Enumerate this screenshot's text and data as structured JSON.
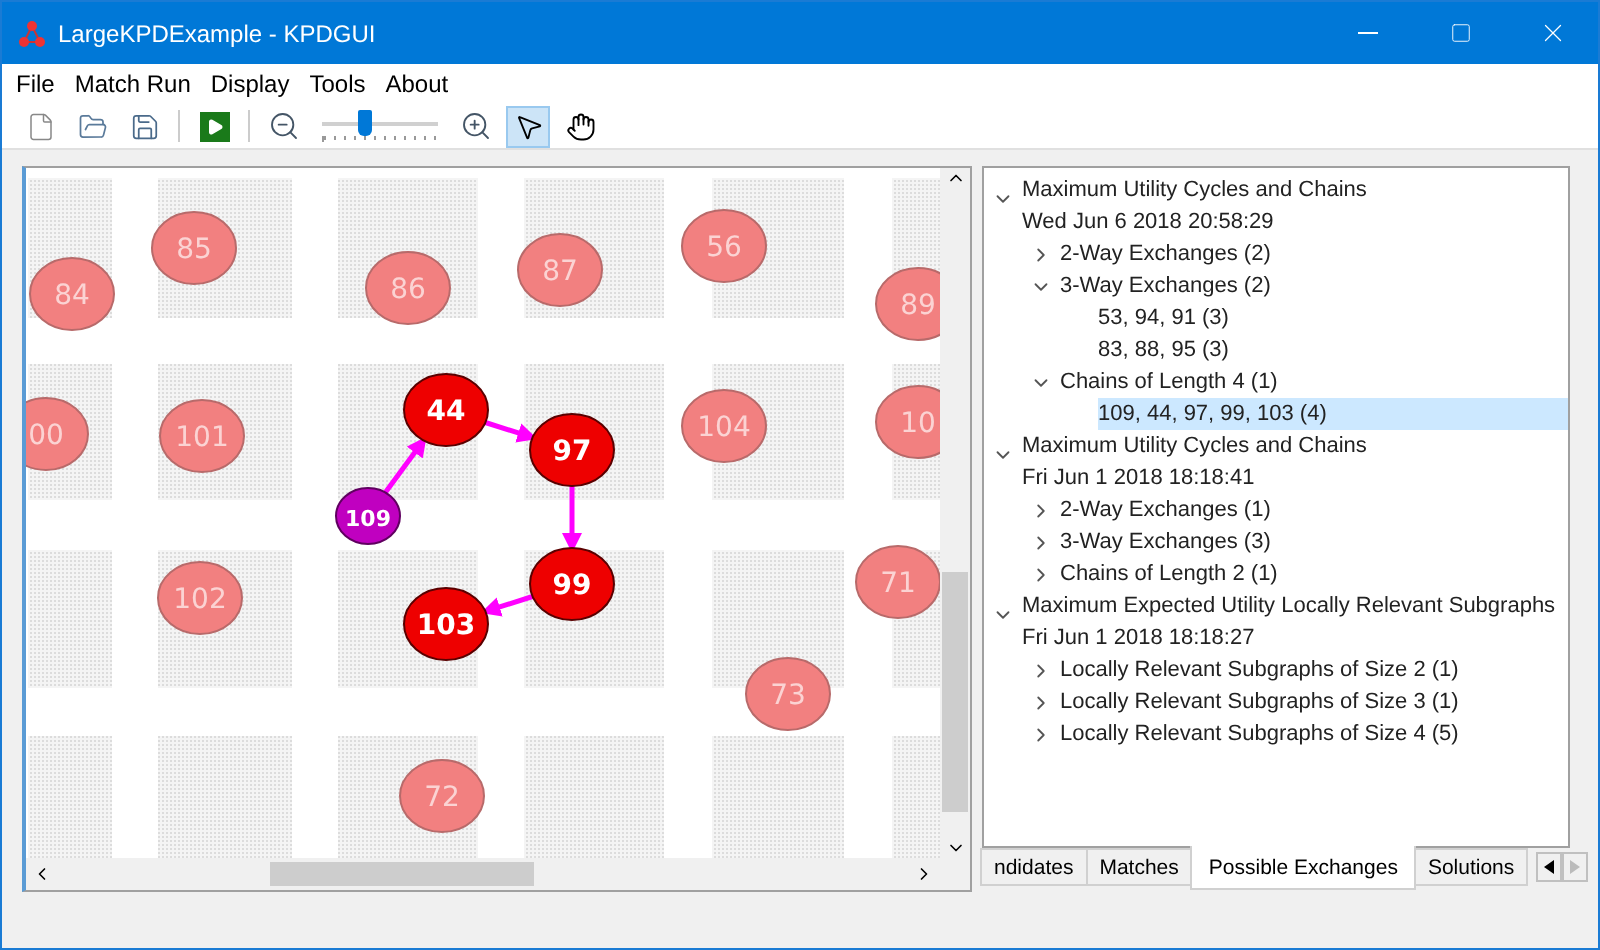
{
  "window": {
    "title": "LargeKPDExample - KPDGUI"
  },
  "menu": [
    "File",
    "Match Run",
    "Display",
    "Tools",
    "About"
  ],
  "toolbar": {
    "zoom": {
      "level": 0.36
    },
    "tools": [
      {
        "kind": "pointer",
        "selected": true
      },
      {
        "kind": "hand",
        "selected": false
      }
    ]
  },
  "graph": {
    "nodes": [
      {
        "label": "84",
        "kind": "unmatched"
      },
      {
        "label": "85",
        "kind": "unmatched"
      },
      {
        "label": "86",
        "kind": "unmatched"
      },
      {
        "label": "87",
        "kind": "unmatched"
      },
      {
        "label": "56",
        "kind": "unmatched"
      },
      {
        "label": "89",
        "kind": "unmatched"
      },
      {
        "label": "00",
        "kind": "unmatched"
      },
      {
        "label": "101",
        "kind": "unmatched"
      },
      {
        "label": "44",
        "kind": "matched"
      },
      {
        "label": "97",
        "kind": "matched"
      },
      {
        "label": "104",
        "kind": "unmatched"
      },
      {
        "label": "10",
        "kind": "unmatched"
      },
      {
        "label": "109",
        "kind": "donor"
      },
      {
        "label": "102",
        "kind": "unmatched"
      },
      {
        "label": "99",
        "kind": "matched"
      },
      {
        "label": "103",
        "kind": "matched"
      },
      {
        "label": "71",
        "kind": "unmatched"
      },
      {
        "label": "73",
        "kind": "unmatched"
      },
      {
        "label": "72",
        "kind": "unmatched"
      }
    ]
  },
  "tree": [
    {
      "title": "Maximum Utility Cycles and Chains",
      "date": "Wed Jun 6 2018 20:58:29",
      "expanded": true,
      "selected": false,
      "children": [
        {
          "label": "2-Way Exchanges (2)",
          "expanded": false,
          "selected": false
        },
        {
          "label": "3-Way Exchanges (2)",
          "expanded": true,
          "selected": false,
          "children": [
            {
              "label": "53, 94, 91 (3)",
              "selected": false
            },
            {
              "label": "83, 88, 95 (3)",
              "selected": false
            }
          ]
        },
        {
          "label": "Chains of Length 4 (1)",
          "expanded": true,
          "selected": false,
          "children": [
            {
              "label": "109, 44, 97, 99, 103 (4)",
              "selected": true
            }
          ]
        }
      ]
    },
    {
      "title": "Maximum Utility Cycles and Chains",
      "date": "Fri Jun 1 2018 18:18:41",
      "expanded": true,
      "selected": false,
      "children": [
        {
          "label": "2-Way Exchanges (1)",
          "expanded": false,
          "selected": false
        },
        {
          "label": "3-Way Exchanges (3)",
          "expanded": false,
          "selected": false
        },
        {
          "label": "Chains of Length 2 (1)",
          "expanded": false,
          "selected": false
        }
      ]
    },
    {
      "title": "Maximum Expected Utility Locally Relevant Subgraphs",
      "date": "Fri Jun 1 2018 18:18:27",
      "expanded": true,
      "selected": false,
      "children": [
        {
          "label": "Locally Relevant Subgraphs of Size 2 (1)",
          "expanded": false,
          "selected": false
        },
        {
          "label": "Locally Relevant Subgraphs of Size 3 (1)",
          "expanded": false,
          "selected": false
        },
        {
          "label": "Locally Relevant Subgraphs of Size 4 (5)",
          "expanded": false,
          "selected": false
        }
      ]
    }
  ],
  "tabs": [
    {
      "label": "ndidates",
      "selected": false
    },
    {
      "label": "Matches",
      "selected": false
    },
    {
      "label": "Possible Exchanges",
      "selected": true
    },
    {
      "label": "Solutions",
      "selected": false
    }
  ]
}
